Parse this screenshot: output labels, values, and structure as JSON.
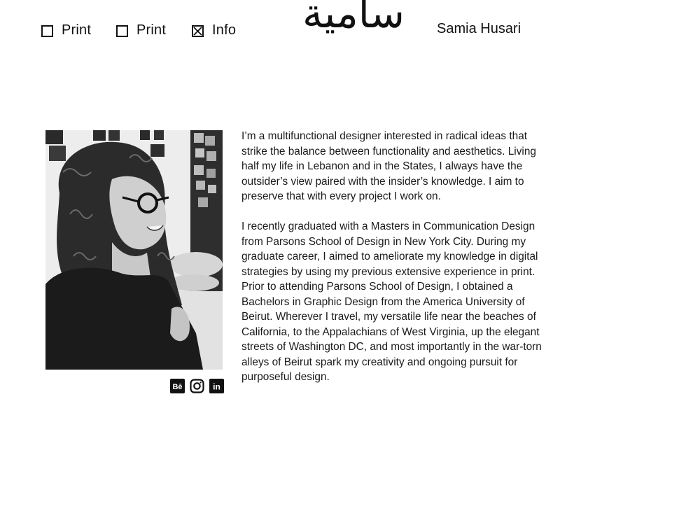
{
  "nav": {
    "items": [
      {
        "label": "Print",
        "checked": false
      },
      {
        "label": "Print",
        "checked": false
      },
      {
        "label": "Info",
        "checked": true
      }
    ]
  },
  "logo": {
    "text": "سامية"
  },
  "header": {
    "name": "Samia Husari"
  },
  "photo": {
    "icon": "portrait-photo"
  },
  "socials": [
    {
      "name": "behance-icon",
      "text": "Bē"
    },
    {
      "name": "instagram-icon"
    },
    {
      "name": "linkedin-icon",
      "text": "in"
    }
  ],
  "bio": {
    "paragraphs": [
      "I’m a multifunctional designer interested in radical ideas that strike the balance between functionality and aesthetics. Living half my life in Lebanon and in the States, I always have the outsider’s view paired with the insider’s knowledge. I aim to preserve that with every project I work on.",
      "I recently graduated with a Masters in Communication Design from Parsons School of Design in New York City. During my graduate career, I aimed to ameliorate my knowledge in digital strategies by using my previous extensive experience in print. Prior to attending Parsons School of Design, I obtained a Bachelors in Graphic Design from the America University of Beirut. Wherever I travel, my versatile life near the beaches of California, to the Appalachians of West Virginia, up the elegant streets of Washington DC, and most importantly in the war-torn alleys of Beirut spark my creativity and ongoing pursuit for purposeful design."
    ]
  },
  "colors": {
    "text": "#111111",
    "background": "#ffffff"
  }
}
